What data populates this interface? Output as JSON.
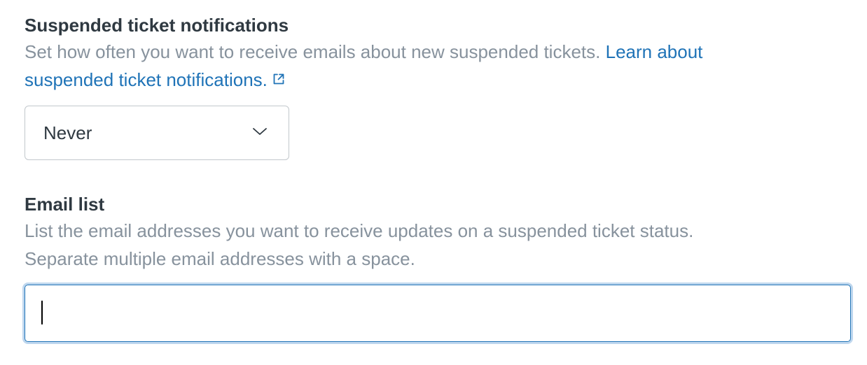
{
  "notifications": {
    "heading": "Suspended ticket notifications",
    "description": "Set how often you want to receive emails about new suspended tickets.",
    "learn_link_line1": "Learn about",
    "learn_link_line2": "suspended ticket notifications.",
    "external_icon": "external-link-icon",
    "frequency_select": {
      "selected": "Never",
      "icon": "chevron-down-icon"
    }
  },
  "email_list": {
    "heading": "Email list",
    "hint_line1": "List the email addresses you want to receive updates on a suspended ticket status.",
    "hint_line2": "Separate multiple email addresses with a space.",
    "input_value": "",
    "input_placeholder": ""
  },
  "colors": {
    "heading": "#2f3941",
    "hint": "#87929d",
    "link": "#1f73b7",
    "focus_border": "#1f73b7",
    "focus_ring": "#bfd7ee",
    "select_border": "#c2c8cc"
  }
}
